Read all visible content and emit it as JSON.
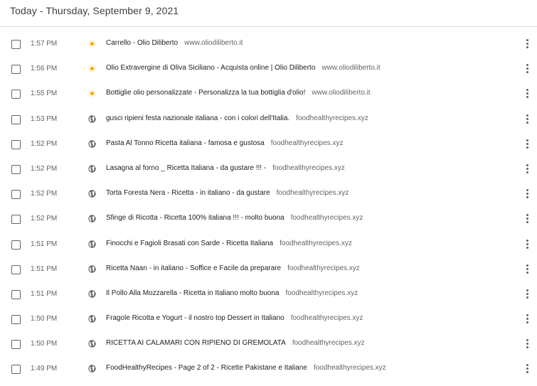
{
  "header": {
    "title": "Today - Thursday, September 9, 2021"
  },
  "history": [
    {
      "time": "1:57 PM",
      "title": "Carrello - Olio Diliberto",
      "domain": "www.oliodiliberto.it",
      "icon": "sun-favicon-icon"
    },
    {
      "time": "1:56 PM",
      "title": "Olio Extravergine di Oliva Siciliano - Acquista online | Olio Diliberto",
      "domain": "www.oliodiliberto.it",
      "icon": "sun-favicon-icon"
    },
    {
      "time": "1:55 PM",
      "title": "Bottiglie olio personalizzate - Personalizza la tua bottiglia d'olio!",
      "domain": "www.oliodiliberto.it",
      "icon": "sun-favicon-icon"
    },
    {
      "time": "1:53 PM",
      "title": "gusci ripieni festa nazionale italiana - con i colori dell'Italia.",
      "domain": "foodhealthyrecipes.xyz",
      "icon": "globe-icon"
    },
    {
      "time": "1:52 PM",
      "title": "Pasta Al Tonno Ricetta italiana - famosa e gustosa",
      "domain": "foodhealthyrecipes.xyz",
      "icon": "globe-icon"
    },
    {
      "time": "1:52 PM",
      "title": "Lasagna al forno _ Ricetta Italiana - da gustare !!! -",
      "domain": "foodhealthyrecipes.xyz",
      "icon": "globe-icon"
    },
    {
      "time": "1:52 PM",
      "title": "Torta Foresta Nera - Ricetta - in italiano - da gustare",
      "domain": "foodhealthyrecipes.xyz",
      "icon": "globe-icon"
    },
    {
      "time": "1:52 PM",
      "title": "Sfinge di Ricotta - Ricetta 100% italiana !!! - molto buona",
      "domain": "foodhealthyrecipes.xyz",
      "icon": "globe-icon"
    },
    {
      "time": "1:51 PM",
      "title": "Finocchi e Fagioli Brasati con Sarde - Ricetta Italiana",
      "domain": "foodhealthyrecipes.xyz",
      "icon": "globe-icon"
    },
    {
      "time": "1:51 PM",
      "title": "Ricetta Naan - in italiano - Soffice e Facile da preparare",
      "domain": "foodhealthyrecipes.xyz",
      "icon": "globe-icon"
    },
    {
      "time": "1:51 PM",
      "title": "Il Pollo Alla Mozzarella - Ricetta in Italiano molto buona",
      "domain": "foodhealthyrecipes.xyz",
      "icon": "globe-icon"
    },
    {
      "time": "1:50 PM",
      "title": "Fragole Ricotta e Yogurt - il nostro top Dessert in Italiano",
      "domain": "foodhealthyrecipes.xyz",
      "icon": "globe-icon"
    },
    {
      "time": "1:50 PM",
      "title": "RICETTA AI CALAMARI CON RIPIENO DI GREMOLATA",
      "domain": "foodhealthyrecipes.xyz",
      "icon": "globe-icon"
    },
    {
      "time": "1:49 PM",
      "title": "FoodHealthyRecipes - Page 2 of 2 - Ricette Pakistane e Italiane",
      "domain": "foodhealthyrecipes.xyz",
      "icon": "globe-icon"
    }
  ],
  "colors": {
    "sun_favicon": "#f9ab00",
    "globe_favicon": "#5f6368"
  }
}
